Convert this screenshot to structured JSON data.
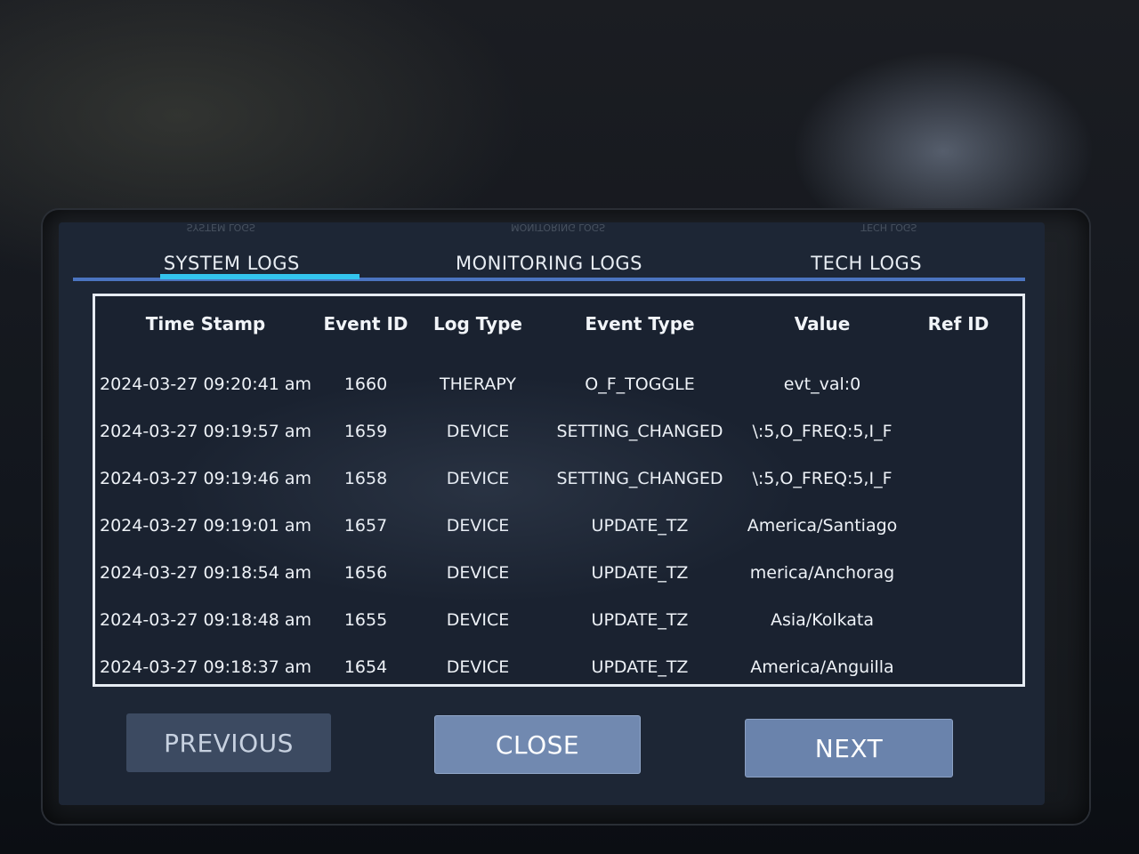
{
  "ghost_labels": [
    "SYSTEM LOGS",
    "MONITORING LOGS",
    "TECH LOGS"
  ],
  "tabs": [
    {
      "label": "SYSTEM LOGS",
      "active": true
    },
    {
      "label": "MONITORING LOGS",
      "active": false
    },
    {
      "label": "TECH LOGS",
      "active": false
    }
  ],
  "colors": {
    "tab_active_indicator": "#33c4ee",
    "tab_underline": "#4b74c0",
    "screen_bg": "#1d2635",
    "button_primary": "#7189b0"
  },
  "table": {
    "columns": [
      "Time Stamp",
      "Event ID",
      "Log Type",
      "Event Type",
      "Value",
      "Ref ID"
    ],
    "rows": [
      [
        "2024-03-27 09:20:41 am",
        "1660",
        "THERAPY",
        "O_F_TOGGLE",
        "evt_val:0",
        ""
      ],
      [
        "2024-03-27 09:19:57 am",
        "1659",
        "DEVICE",
        "SETTING_CHANGED",
        "\\:5,O_FREQ:5,I_F",
        ""
      ],
      [
        "2024-03-27 09:19:46 am",
        "1658",
        "DEVICE",
        "SETTING_CHANGED",
        "\\:5,O_FREQ:5,I_F",
        ""
      ],
      [
        "2024-03-27 09:19:01 am",
        "1657",
        "DEVICE",
        "UPDATE_TZ",
        "America/Santiago",
        ""
      ],
      [
        "2024-03-27 09:18:54 am",
        "1656",
        "DEVICE",
        "UPDATE_TZ",
        "merica/Anchorag",
        ""
      ],
      [
        "2024-03-27 09:18:48 am",
        "1655",
        "DEVICE",
        "UPDATE_TZ",
        "Asia/Kolkata",
        ""
      ],
      [
        "2024-03-27 09:18:37 am",
        "1654",
        "DEVICE",
        "UPDATE_TZ",
        "America/Anguilla",
        ""
      ]
    ]
  },
  "buttons": {
    "previous": "PREVIOUS",
    "close": "CLOSE",
    "next": "NEXT"
  }
}
